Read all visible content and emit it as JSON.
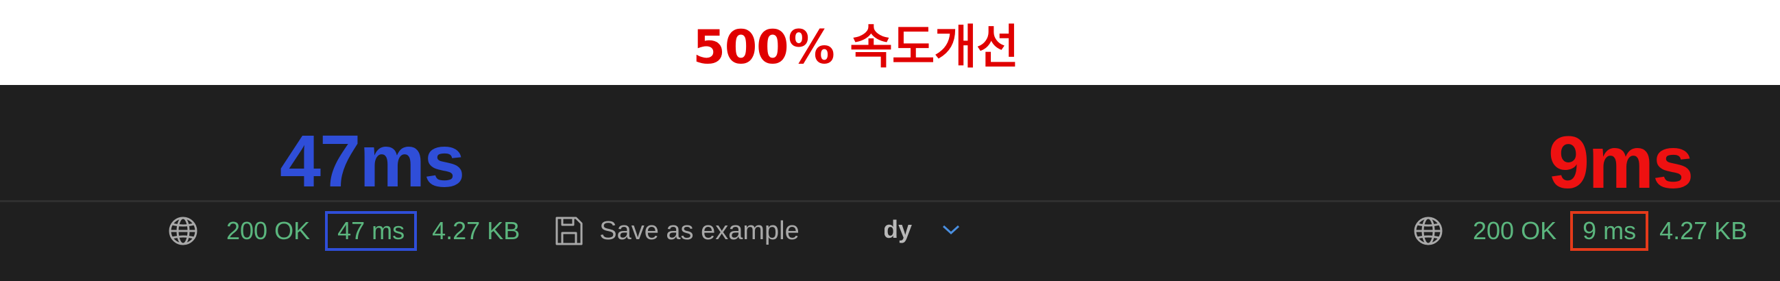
{
  "headline": "500% 속도개선",
  "before": {
    "timing_label": "47ms",
    "status": "200 OK",
    "time": "47 ms",
    "size": "4.27 KB",
    "save_label": "Save as example"
  },
  "after": {
    "body_tab": "Body",
    "timing_label": "9ms",
    "status": "200 OK",
    "time": "9 ms",
    "size": "4.27 KB"
  },
  "colors": {
    "headline": "#e00000",
    "before_accent": "#2f4ed8",
    "after_accent": "#ee1111",
    "status_green": "#5bb67e",
    "panel_bg": "#1f1f1f"
  },
  "icons": [
    "globe-icon",
    "save-icon",
    "chevron-down-icon"
  ]
}
